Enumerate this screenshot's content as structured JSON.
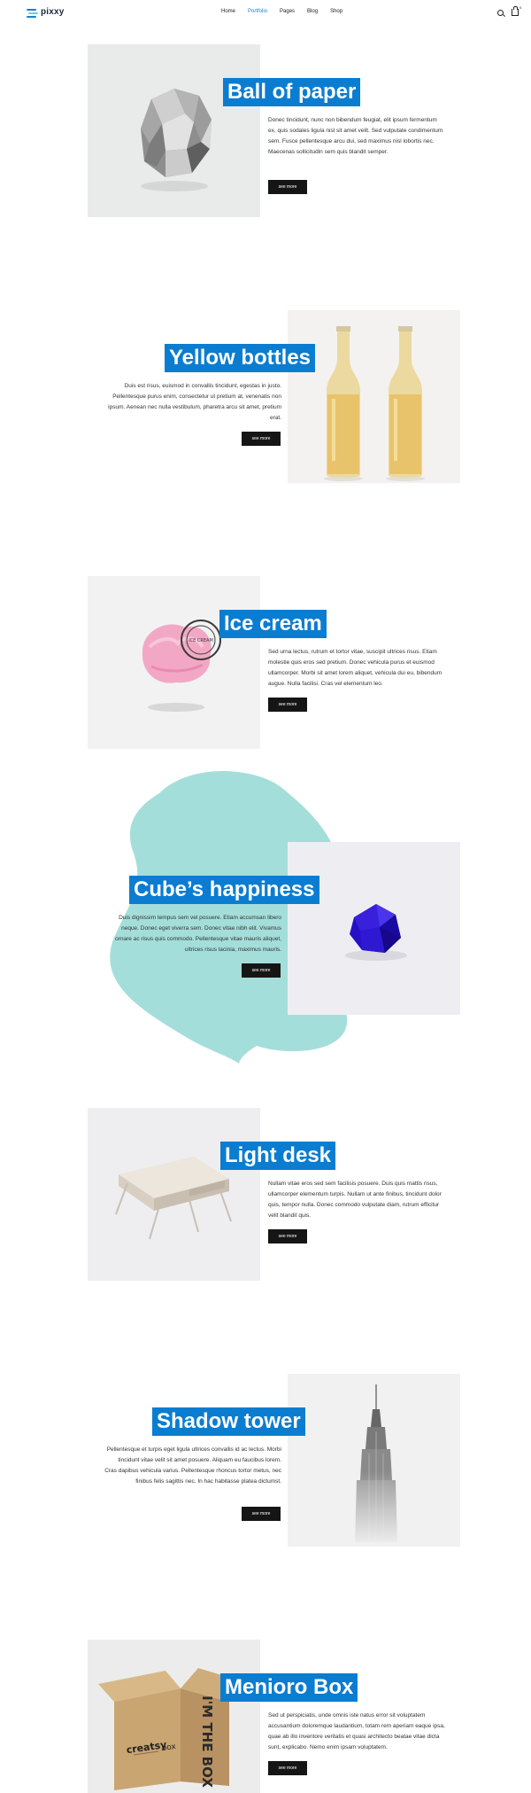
{
  "header": {
    "brand": "pixxy",
    "nav": [
      "Home",
      "Portfolio",
      "Pages",
      "Blog",
      "Shop"
    ],
    "nav_active": "Portfolio",
    "cart_count": "0"
  },
  "colors": {
    "accent": "#0b7dd1",
    "button": "#151515",
    "blob": "#9fdcd8"
  },
  "items": [
    {
      "title": "Ball of paper",
      "text": "Donec tincidunt, nunc non bibendum feugiat, elit ipsum fermentum ex, quis sodales ligula nisl sit amet velit. Sed vulputate condimentum sem. Fusce pellentesque arcu dui, sed maximus nisl lobortis nec. Maecenas sollicitudin sem quis blandit semper.",
      "button": "see more",
      "image": "crumpled-paper-ball"
    },
    {
      "title": "Yellow bottles",
      "text": "Duis est risus, euismod in convallis tincidunt, egestas in justo. Pellentesque purus enim, consectetur ut pretium at, venenatis non ipsum. Aenean nec nulla vestibulum, pharetra arcu sit amet, pretium erat.",
      "button": "see more",
      "image": "two-yellow-bottles"
    },
    {
      "title": "Ice cream",
      "text": "Sed urna lectus, rutrum et tortor vitae, suscipit ultrices risus. Etiam molestie quis eros sed pretium. Donec vehicula purus et euismod ullamcorper. Morbi sit amet lorem aliquet, vehicula dui eu, bibendum augue. Nulla facilisi. Cras vel elementum leo.",
      "button": "see more",
      "image": "pink-ice-cream-scoop",
      "stamp": "ICE CREAM"
    },
    {
      "title": "Cube’s happiness",
      "text": "Duis dignissim tempus sem vel posuere. Etiam accumsan libero neque. Donec eget viverra sem. Donec vitae nibh elit. Vivamus ornare ac risus quis commodo. Pellentesque vitae mauris aliquet, ultrices risus lacinia, maximus mauris.",
      "button": "see more",
      "image": "blue-polyhedron"
    },
    {
      "title": "Light desk",
      "text": "Nullam vitae eros sed sem facilisis posuere. Duis quis mattis risus, ullamcorper elementum turpis. Nullam ut ante finibus, tincidunt dolor quis, tempor nulla. Donec commodo vulputate diam, rutrum efficitur velit blandit quis.",
      "button": "see more",
      "image": "light-wooden-desk"
    },
    {
      "title": "Shadow tower",
      "text": "Pellentesque et turpis eget ligula ultrices convallis id ac lectus. Morbi tincidunt vitae velit sit amet posuere. Aliquam eu faucibus lorem. Cras dapibus vehicula varius. Pellentesque rhoncus tortor metus, nec finibus felis sagittis nec. In hac habitasse platea dictumst.",
      "button": "see more",
      "image": "skyscraper-in-fog"
    },
    {
      "title": "Menioro Box",
      "text": "Sed ut perspiciatis, unde omnis iste natus error sit voluptatem accusantium doloremque laudantium, totam rem aperiam eaque ipsa, quae ab illo inventore veritatis et quasi architecto beatae vitae dicta sunt, explicabo. Nemo enim ipsam voluptatem.",
      "button": "see more",
      "image": "cardboard-box",
      "box_print": {
        "side_big": "I'M THE BOX",
        "front_brand": "creatsy",
        "front_word": "box"
      }
    }
  ]
}
